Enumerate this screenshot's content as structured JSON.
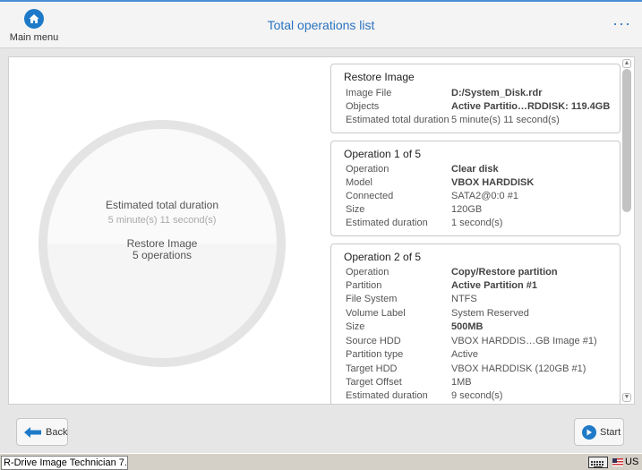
{
  "header": {
    "home_label": "Main menu",
    "title": "Total operations list",
    "more_label": "···"
  },
  "summary": {
    "label": "Estimated total duration",
    "value": "5 minute(s) 11 second(s)",
    "name": "Restore Image",
    "count": "5 operations"
  },
  "cards": [
    {
      "title": "Restore Image",
      "rows": [
        {
          "k": "Image File",
          "v": "D:/System_Disk.rdr"
        },
        {
          "k": "Objects",
          "v": "Active Partitio…RDDISK: 119.4GB"
        },
        {
          "k": "Estimated total duration",
          "v": "5 minute(s) 11 second(s)"
        }
      ]
    },
    {
      "title": "Operation 1 of 5",
      "rows": [
        {
          "k": "Operation",
          "v": "Clear disk"
        },
        {
          "k": "Model",
          "v": "VBOX HARDDISK"
        },
        {
          "k": "Connected",
          "v": "SATA2@0:0 #1"
        },
        {
          "k": "Size",
          "v": "120GB"
        },
        {
          "k": "Estimated duration",
          "v": "1 second(s)"
        }
      ]
    },
    {
      "title": "Operation 2 of 5",
      "rows": [
        {
          "k": "Operation",
          "v": "Copy/Restore partition"
        },
        {
          "k": "Partition",
          "v": "Active Partition #1"
        },
        {
          "k": "File System",
          "v": "NTFS"
        },
        {
          "k": "Volume Label",
          "v": "System Reserved"
        },
        {
          "k": "Size",
          "v": "500MB"
        },
        {
          "k": "Source HDD",
          "v": "VBOX HARDDIS…GB Image #1)"
        },
        {
          "k": "Partition type",
          "v": "Active"
        },
        {
          "k": "Target HDD",
          "v": "VBOX HARDDISK (120GB #1)"
        },
        {
          "k": "Target Offset",
          "v": "1MB"
        },
        {
          "k": "Estimated duration",
          "v": "9 second(s)"
        }
      ]
    }
  ],
  "footer": {
    "back_label": "Back",
    "start_label": "Start"
  },
  "taskbar": {
    "task_label": "R-Drive Image Technician 7.…",
    "lang_label": "US"
  },
  "colors": {
    "accent": "#1e7ac8",
    "title": "#2a73c0"
  }
}
